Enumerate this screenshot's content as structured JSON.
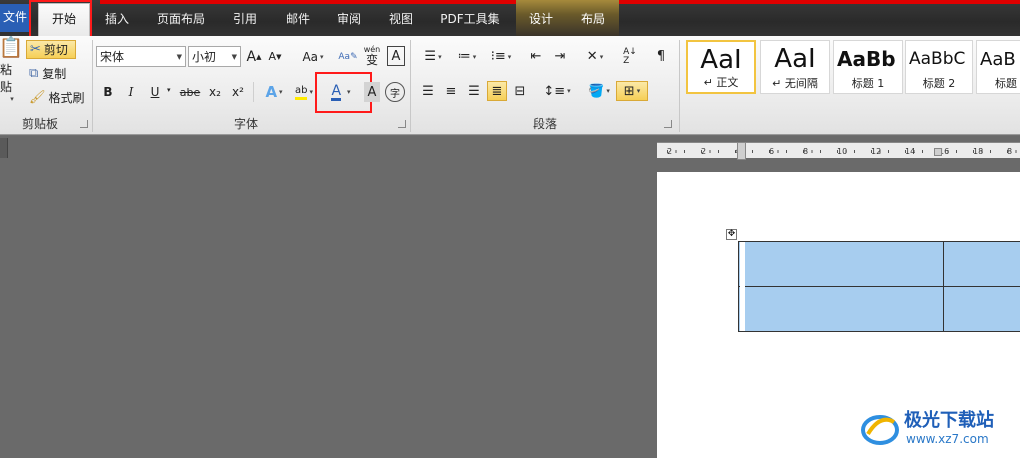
{
  "tabs": {
    "file": "文件",
    "home": "开始",
    "insert": "插入",
    "layout": "页面布局",
    "references": "引用",
    "mailings": "邮件",
    "review": "审阅",
    "view": "视图",
    "pdf": "PDF工具集",
    "design": "设计",
    "table_layout": "布局"
  },
  "clipboard": {
    "paste": "粘贴",
    "cut": "剪切",
    "copy": "复制",
    "format_painter": "格式刷",
    "group_label": "剪贴板"
  },
  "font": {
    "font_name": "宋体",
    "font_size": "小初",
    "grow": "A",
    "shrink": "A",
    "change_case": "Aa",
    "wen": "wén",
    "wen_char": "变",
    "border_char": "A",
    "bold": "B",
    "italic": "I",
    "underline": "U",
    "strike": "abe",
    "subscript": "x₂",
    "superscript": "x²",
    "text_effect": "A",
    "highlight": "ab",
    "font_color": "A",
    "char_shading": "A",
    "enclose": "字",
    "group_label": "字体"
  },
  "paragraph": {
    "group_label": "段落"
  },
  "styles": [
    {
      "sample": "AaI",
      "label": "↵ 正文"
    },
    {
      "sample": "AaI",
      "label": "↵ 无间隔"
    },
    {
      "sample": "AaBb",
      "label": "标题 1"
    },
    {
      "sample": "AaBbC",
      "label": "标题 2"
    },
    {
      "sample": "AaB",
      "label": "标题"
    }
  ],
  "ruler": {
    "ticks": [
      "2",
      "2",
      "4",
      "6",
      "8",
      "10",
      "12",
      "14",
      "16",
      "18",
      "8"
    ]
  },
  "watermark": {
    "brand": "极光下载站",
    "url": "www.xz7.com"
  },
  "colors": {
    "accent_red": "#ff1a1a",
    "table_fill": "#a7cdef",
    "file_tab": "#2a5fb5"
  }
}
